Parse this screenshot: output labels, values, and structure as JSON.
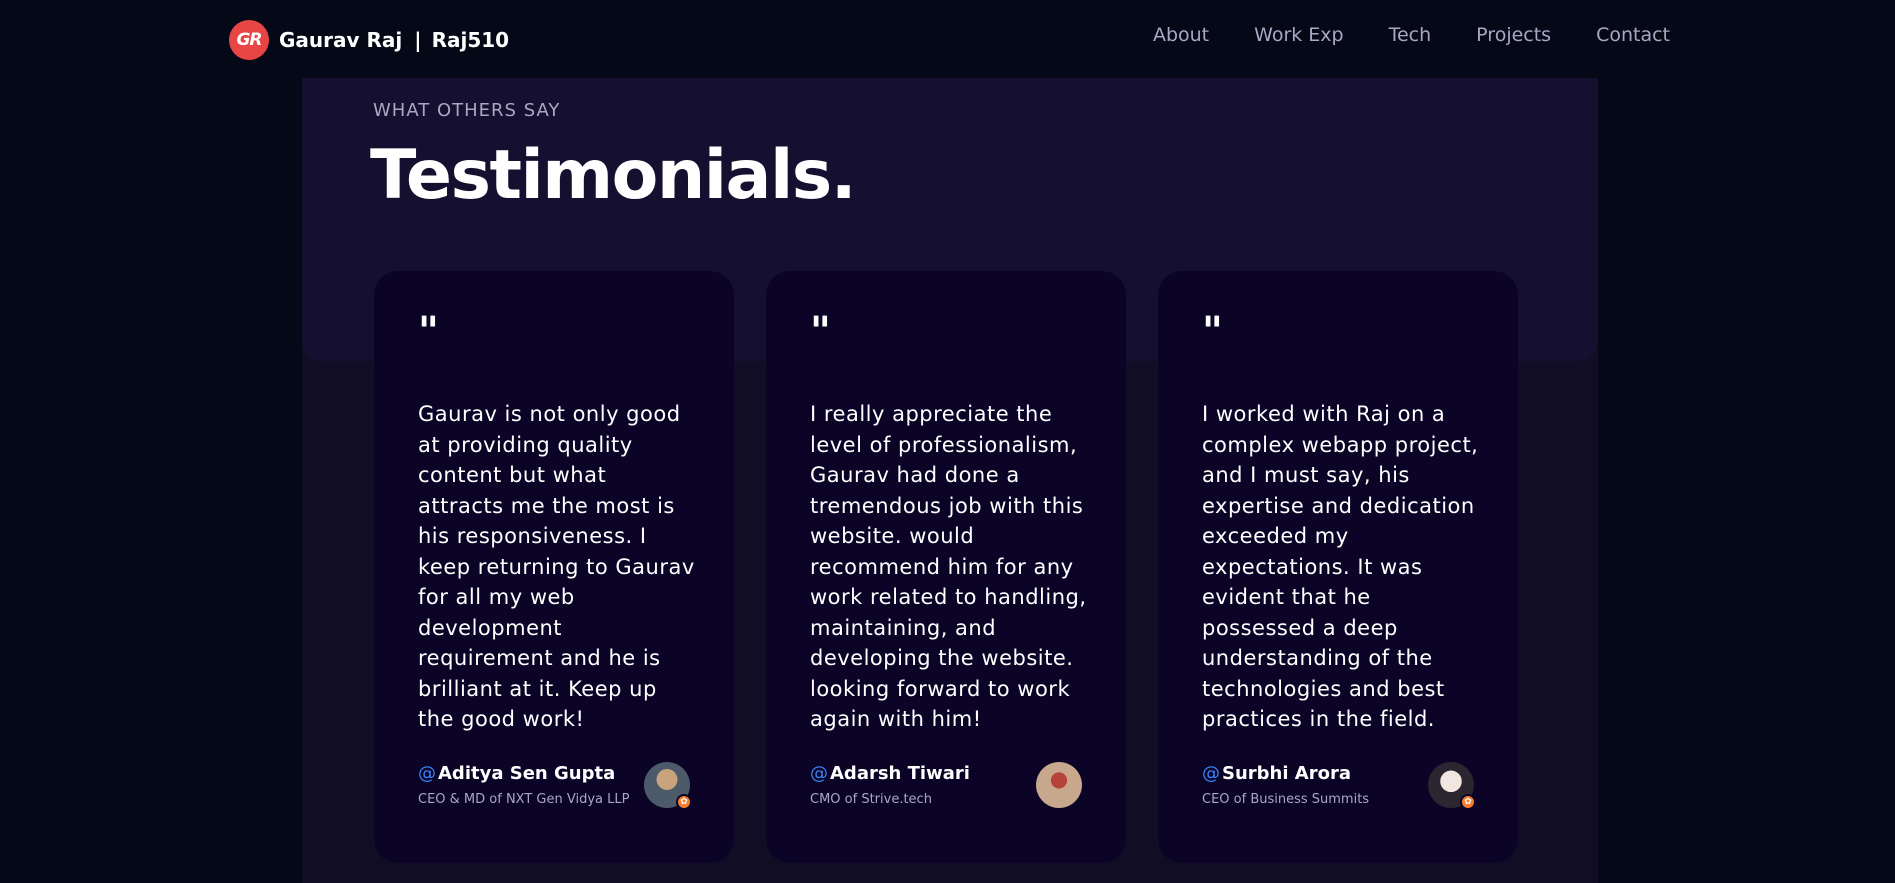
{
  "brand": {
    "logo_text": "GR",
    "name": "Gaurav Raj",
    "separator": "|",
    "handle": "Raj510"
  },
  "nav": {
    "links": [
      "About",
      "Work Exp",
      "Tech",
      "Projects",
      "Contact"
    ]
  },
  "section": {
    "subtitle": "What others say",
    "title": "Testimonials."
  },
  "testimonials": [
    {
      "quote_mark": "\"",
      "text": "Gaurav is not only good at providing quality content but what attracts me the most is his responsiveness. I keep returning to Gaurav for all my web development requirement and he is brilliant at it. Keep up the good work!",
      "at": "@",
      "name": "Aditya Sen Gupta",
      "role": "CEO & MD of NXT Gen Vidya LLP",
      "avatar": "avatar-photo",
      "badge": true
    },
    {
      "quote_mark": "\"",
      "text": "I really appreciate the level of professionalism, Gaurav had done a tremendous job with this website. would recommend him for any work related to handling, maintaining, and developing the website. looking forward to work again with him!",
      "at": "@",
      "name": "Adarsh Tiwari",
      "role": "CMO of Strive.tech",
      "avatar": "avatar-photo",
      "badge": false
    },
    {
      "quote_mark": "\"",
      "text": "I worked with Raj on a complex webapp project, and I must say, his expertise and dedication exceeded my expectations. It was evident that he possessed a deep understanding of the technologies and best practices in the field.",
      "at": "@",
      "name": "Surbhi Arora",
      "role": "CEO of Business Summits",
      "avatar": "avatar-photo",
      "badge": true
    }
  ],
  "colors": {
    "background": "#050816",
    "panel": "#151030",
    "card": "#0b0427",
    "accent_logo": "#e84545",
    "secondary_text": "#aaa6c3",
    "at_symbol": "#3b82f6"
  }
}
